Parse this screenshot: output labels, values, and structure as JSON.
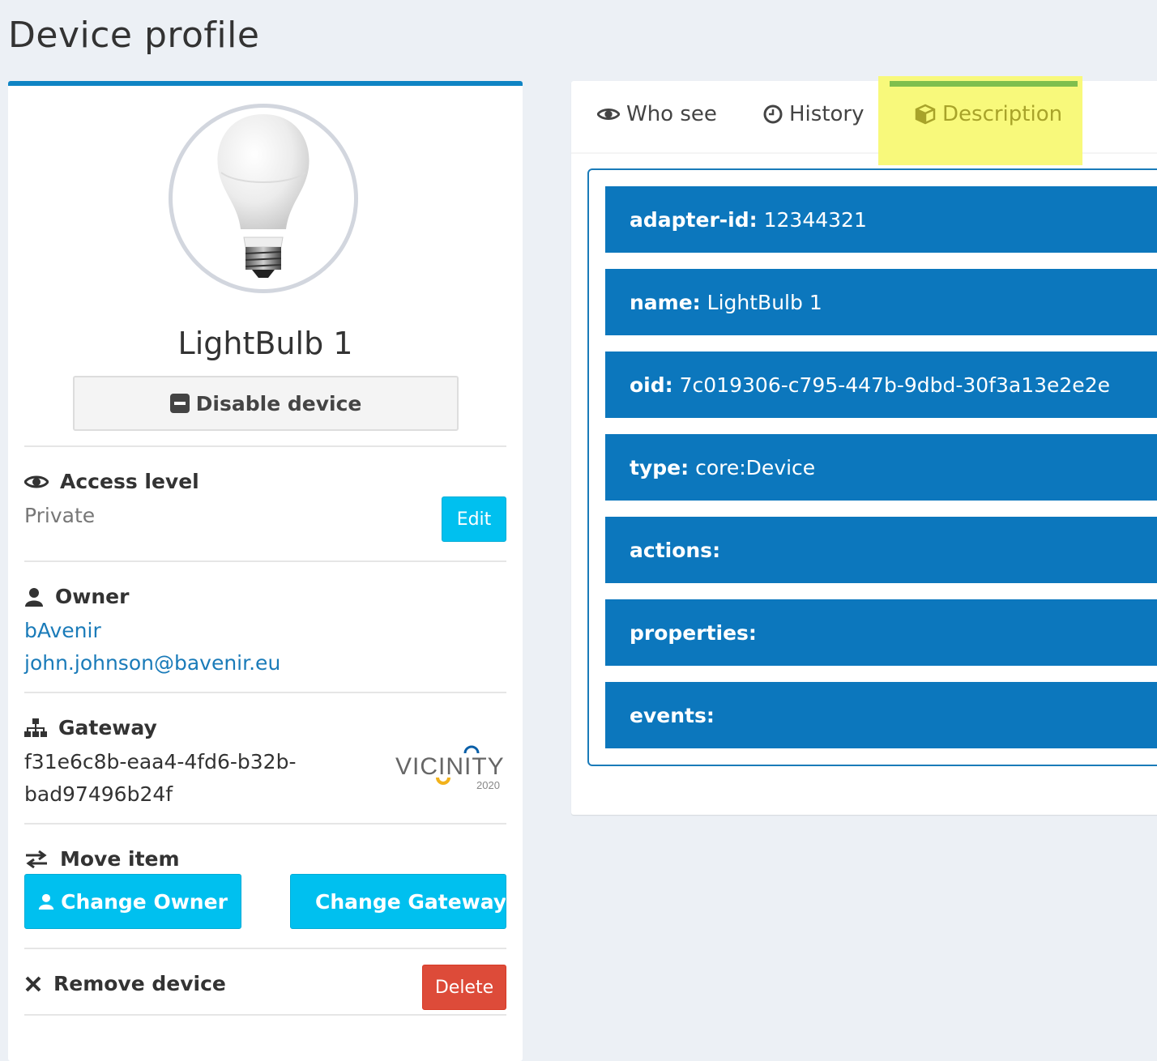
{
  "page": {
    "title": "Device profile"
  },
  "profile": {
    "device_name": "LightBulb 1",
    "disable_label": "Disable device",
    "access": {
      "heading": "Access level",
      "value": "Private",
      "edit_label": "Edit"
    },
    "owner": {
      "heading": "Owner",
      "org": "bAvenir",
      "email": "john.johnson@bavenir.eu"
    },
    "gateway": {
      "heading": "Gateway",
      "id_line1": "f31e6c8b-eaa4-4fd6-b32b-",
      "id_line2": "bad97496b24f",
      "logo_text": "VICINITY",
      "logo_year": "2020"
    },
    "move": {
      "heading": "Move item",
      "change_owner": "Change Owner",
      "change_gateway": "Change Gateway"
    },
    "remove": {
      "heading": "Remove device",
      "delete_label": "Delete"
    }
  },
  "tabs": {
    "items": [
      {
        "label": "Who see",
        "icon": "eye-icon"
      },
      {
        "label": "History",
        "icon": "clock-icon"
      },
      {
        "label": "Description",
        "icon": "cube-icon",
        "active": true
      }
    ]
  },
  "description": {
    "rows": [
      {
        "key": "adapter-id:",
        "value": "12344321"
      },
      {
        "key": "name:",
        "value": "LightBulb 1"
      },
      {
        "key": "oid:",
        "value": "7c019306-c795-447b-9dbd-30f3a13e2e2e"
      },
      {
        "key": "type:",
        "value": "core:Device"
      },
      {
        "key": "actions:",
        "value": ""
      },
      {
        "key": "properties:",
        "value": ""
      },
      {
        "key": "events:",
        "value": ""
      }
    ]
  },
  "colors": {
    "primary": "#0c77bd",
    "info": "#00c0ef",
    "danger": "#dd4b39",
    "highlight": "#f8f97b",
    "active_tab_bar": "#7fbf4d"
  }
}
